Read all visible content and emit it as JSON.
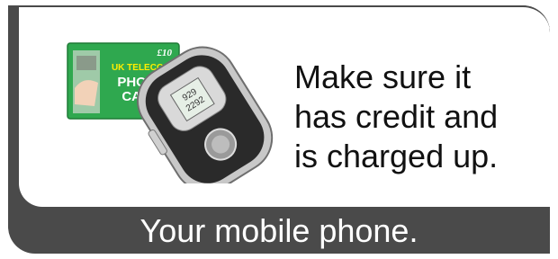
{
  "slide": {
    "message_lines": [
      "Make sure it",
      "has credit and",
      "is charged up."
    ],
    "caption": "Your mobile phone."
  },
  "phone_card": {
    "price": "£10",
    "brand": "UK TELECOM",
    "line1": "PHONE",
    "line2": "CARD",
    "color": "#2fa84f"
  },
  "phone": {
    "screen_text_1": "929",
    "screen_text_2": "2292"
  },
  "colors": {
    "frame": "#4a4a4a",
    "card_green": "#2fa84f"
  }
}
